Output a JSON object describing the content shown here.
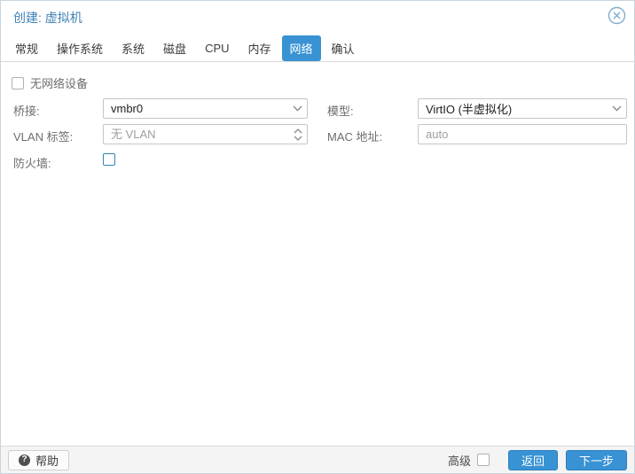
{
  "window": {
    "title": "创建: 虚拟机",
    "close_icon": "circle-x-icon"
  },
  "tabs": {
    "items": [
      {
        "label": "常规"
      },
      {
        "label": "操作系统"
      },
      {
        "label": "系统"
      },
      {
        "label": "磁盘"
      },
      {
        "label": "CPU"
      },
      {
        "label": "内存"
      },
      {
        "label": "网络"
      },
      {
        "label": "确认"
      }
    ],
    "active": "网络"
  },
  "form": {
    "no_network_device": {
      "label": "无网络设备",
      "checked": false
    },
    "bridge": {
      "label": "桥接:",
      "value": "vmbr0"
    },
    "model": {
      "label": "模型:",
      "value": "VirtIO (半虚拟化)"
    },
    "vlan_tag": {
      "label": "VLAN 标签:",
      "placeholder": "无 VLAN"
    },
    "mac_address": {
      "label": "MAC 地址:",
      "placeholder": "auto"
    },
    "firewall": {
      "label": "防火墙:",
      "checked": false
    }
  },
  "footer": {
    "help": {
      "label": "帮助",
      "icon": "question-circle-icon"
    },
    "advanced": {
      "label": "高级",
      "checked": false
    },
    "back": {
      "label": "返回"
    },
    "next": {
      "label": "下一步"
    }
  },
  "colors": {
    "accent": "#3892d4",
    "title_text": "#3e80b4",
    "label_text": "#6e6e6e"
  }
}
